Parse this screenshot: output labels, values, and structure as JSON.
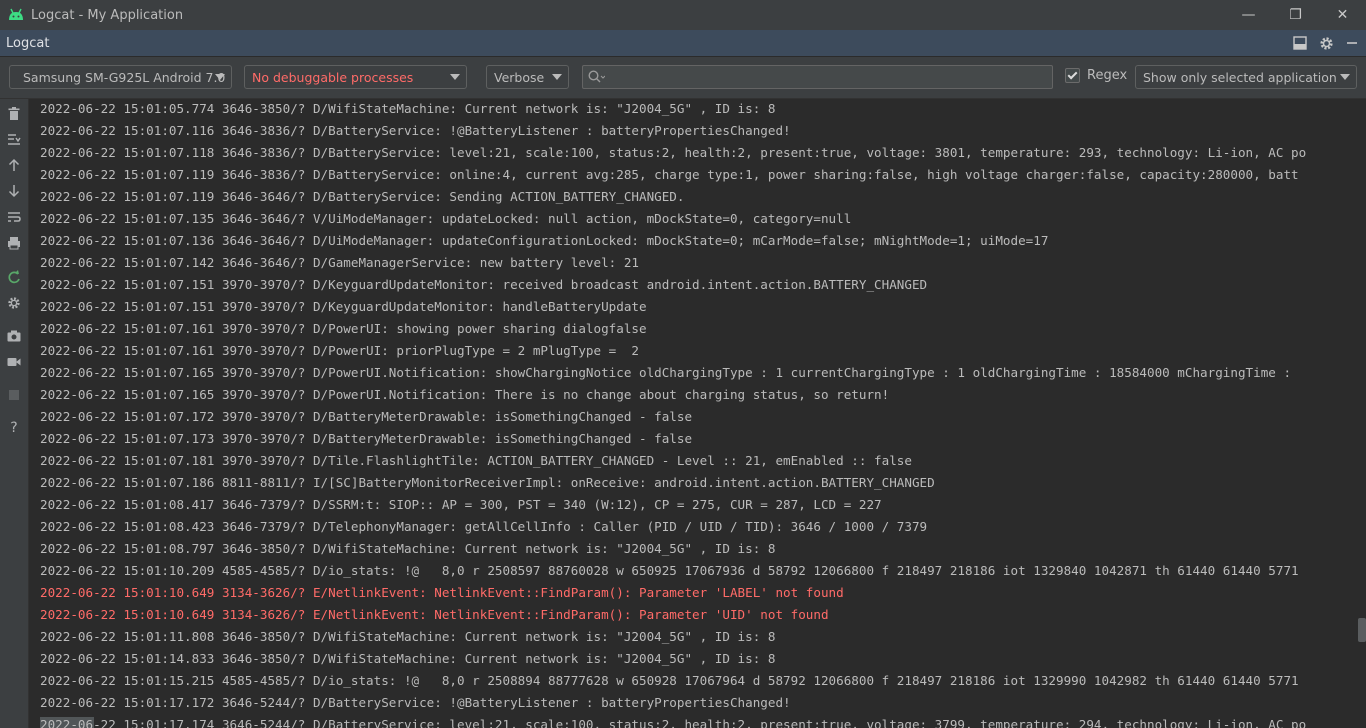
{
  "window": {
    "title": "Logcat - My Application",
    "controls": {
      "minimize": "—",
      "restore": "❐",
      "close": "✕"
    }
  },
  "toolwindow": {
    "title": "Logcat"
  },
  "filterbar": {
    "device": "Samsung SM-G925L Android 7.0",
    "process": "No debuggable processes",
    "level": "Verbose",
    "search_value": "",
    "regex_label": "Regex",
    "regex_checked": true,
    "filter_option": "Show only selected application"
  },
  "colors": {
    "error": "#ff6b68",
    "normal": "#bbbbbb",
    "header": "#3d4b5c"
  },
  "log_lines": [
    {
      "text": "2022-06-22 15:01:05.774 3646-3850/? D/WifiStateMachine: Current network is: \"J2004_5G\" , ID is: 8",
      "level": "D"
    },
    {
      "text": "2022-06-22 15:01:07.116 3646-3836/? D/BatteryService: !@BatteryListener : batteryPropertiesChanged!",
      "level": "D"
    },
    {
      "text": "2022-06-22 15:01:07.118 3646-3836/? D/BatteryService: level:21, scale:100, status:2, health:2, present:true, voltage: 3801, temperature: 293, technology: Li-ion, AC po",
      "level": "D"
    },
    {
      "text": "2022-06-22 15:01:07.119 3646-3836/? D/BatteryService: online:4, current avg:285, charge type:1, power sharing:false, high voltage charger:false, capacity:280000, batt",
      "level": "D"
    },
    {
      "text": "2022-06-22 15:01:07.119 3646-3646/? D/BatteryService: Sending ACTION_BATTERY_CHANGED.",
      "level": "D"
    },
    {
      "text": "2022-06-22 15:01:07.135 3646-3646/? V/UiModeManager: updateLocked: null action, mDockState=0, category=null",
      "level": "V"
    },
    {
      "text": "2022-06-22 15:01:07.136 3646-3646/? D/UiModeManager: updateConfigurationLocked: mDockState=0; mCarMode=false; mNightMode=1; uiMode=17",
      "level": "D"
    },
    {
      "text": "2022-06-22 15:01:07.142 3646-3646/? D/GameManagerService: new battery level: 21",
      "level": "D"
    },
    {
      "text": "2022-06-22 15:01:07.151 3970-3970/? D/KeyguardUpdateMonitor: received broadcast android.intent.action.BATTERY_CHANGED",
      "level": "D"
    },
    {
      "text": "2022-06-22 15:01:07.151 3970-3970/? D/KeyguardUpdateMonitor: handleBatteryUpdate",
      "level": "D"
    },
    {
      "text": "2022-06-22 15:01:07.161 3970-3970/? D/PowerUI: showing power sharing dialogfalse",
      "level": "D"
    },
    {
      "text": "2022-06-22 15:01:07.161 3970-3970/? D/PowerUI: priorPlugType = 2 mPlugType =  2",
      "level": "D"
    },
    {
      "text": "2022-06-22 15:01:07.165 3970-3970/? D/PowerUI.Notification: showChargingNotice oldChargingType : 1 currentChargingType : 1 oldChargingTime : 18584000 mChargingTime :",
      "level": "D"
    },
    {
      "text": "2022-06-22 15:01:07.165 3970-3970/? D/PowerUI.Notification: There is no change about charging status, so return!",
      "level": "D"
    },
    {
      "text": "2022-06-22 15:01:07.172 3970-3970/? D/BatteryMeterDrawable: isSomethingChanged - false",
      "level": "D"
    },
    {
      "text": "2022-06-22 15:01:07.173 3970-3970/? D/BatteryMeterDrawable: isSomethingChanged - false",
      "level": "D"
    },
    {
      "text": "2022-06-22 15:01:07.181 3970-3970/? D/Tile.FlashlightTile: ACTION_BATTERY_CHANGED - Level :: 21, emEnabled :: false",
      "level": "D"
    },
    {
      "text": "2022-06-22 15:01:07.186 8811-8811/? I/[SC]BatteryMonitorReceiverImpl: onReceive: android.intent.action.BATTERY_CHANGED",
      "level": "I"
    },
    {
      "text": "2022-06-22 15:01:08.417 3646-7379/? D/SSRM:t: SIOP:: AP = 300, PST = 340 (W:12), CP = 275, CUR = 287, LCD = 227",
      "level": "D"
    },
    {
      "text": "2022-06-22 15:01:08.423 3646-7379/? D/TelephonyManager: getAllCellInfo : Caller (PID / UID / TID): 3646 / 1000 / 7379",
      "level": "D"
    },
    {
      "text": "2022-06-22 15:01:08.797 3646-3850/? D/WifiStateMachine: Current network is: \"J2004_5G\" , ID is: 8",
      "level": "D"
    },
    {
      "text": "2022-06-22 15:01:10.209 4585-4585/? D/io_stats: !@   8,0 r 2508597 88760028 w 650925 17067936 d 58792 12066800 f 218497 218186 iot 1329840 1042871 th 61440 61440 5771",
      "level": "D"
    },
    {
      "text": "2022-06-22 15:01:10.649 3134-3626/? E/NetlinkEvent: NetlinkEvent::FindParam(): Parameter 'LABEL' not found",
      "level": "E"
    },
    {
      "text": "2022-06-22 15:01:10.649 3134-3626/? E/NetlinkEvent: NetlinkEvent::FindParam(): Parameter 'UID' not found",
      "level": "E"
    },
    {
      "text": "2022-06-22 15:01:11.808 3646-3850/? D/WifiStateMachine: Current network is: \"J2004_5G\" , ID is: 8",
      "level": "D"
    },
    {
      "text": "2022-06-22 15:01:14.833 3646-3850/? D/WifiStateMachine: Current network is: \"J2004_5G\" , ID is: 8",
      "level": "D"
    },
    {
      "text": "2022-06-22 15:01:15.215 4585-4585/? D/io_stats: !@   8,0 r 2508894 88777628 w 650928 17067964 d 58792 12066800 f 218497 218186 iot 1329990 1042982 th 61440 61440 5771",
      "level": "D"
    },
    {
      "text": "2022-06-22 15:01:17.172 3646-5244/? D/BatteryService: !@BatteryListener : batteryPropertiesChanged!",
      "level": "D"
    },
    {
      "text": "2022-06-22 15:01:17.174 3646-5244/? D/BatteryService: level:21, scale:100, status:2, health:2, present:true, voltage: 3799, temperature: 294, technology: Li-ion, AC po",
      "level": "D"
    }
  ]
}
